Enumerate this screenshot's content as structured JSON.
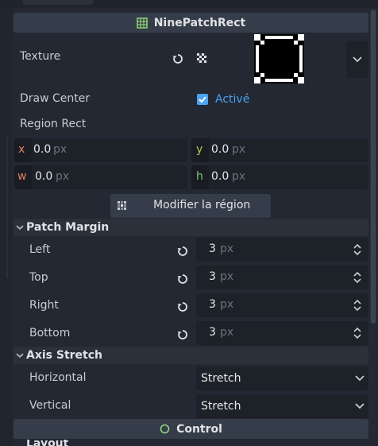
{
  "sections": {
    "ninepatch_title": "NinePatchRect",
    "control_title": "Control"
  },
  "properties": {
    "texture_label": "Texture",
    "draw_center_label": "Draw Center",
    "draw_center_value": "Activé",
    "region_rect_label": "Region Rect",
    "region": {
      "x_label": "x",
      "x_value": "0.0",
      "y_label": "y",
      "y_value": "0.0",
      "w_label": "w",
      "w_value": "0.0",
      "h_label": "h",
      "h_value": "0.0",
      "unit": "px"
    },
    "modify_region_button": "Modifier la région"
  },
  "patch_margin": {
    "title": "Patch Margin",
    "unit": "px",
    "rows": [
      {
        "label": "Left",
        "value": "3"
      },
      {
        "label": "Top",
        "value": "3"
      },
      {
        "label": "Right",
        "value": "3"
      },
      {
        "label": "Bottom",
        "value": "3"
      }
    ]
  },
  "axis_stretch": {
    "title": "Axis Stretch",
    "horizontal_label": "Horizontal",
    "horizontal_value": "Stretch",
    "vertical_label": "Vertical",
    "vertical_value": "Stretch"
  },
  "next_group_label": "Layout",
  "colors": {
    "accent": "#4aa3f0",
    "x_axis": "#e0805f",
    "y_axis": "#b8c94a",
    "w_axis": "#e0805f",
    "h_axis": "#7ec27e",
    "ninepatch_icon": "#8ed67a",
    "control_icon": "#8ed67a"
  },
  "icons": {
    "ninepatch": "grid-icon",
    "reset": "reload-icon",
    "texture_clear": "checker-icon",
    "dropdown": "chevron-down-icon",
    "control": "circle-icon"
  }
}
